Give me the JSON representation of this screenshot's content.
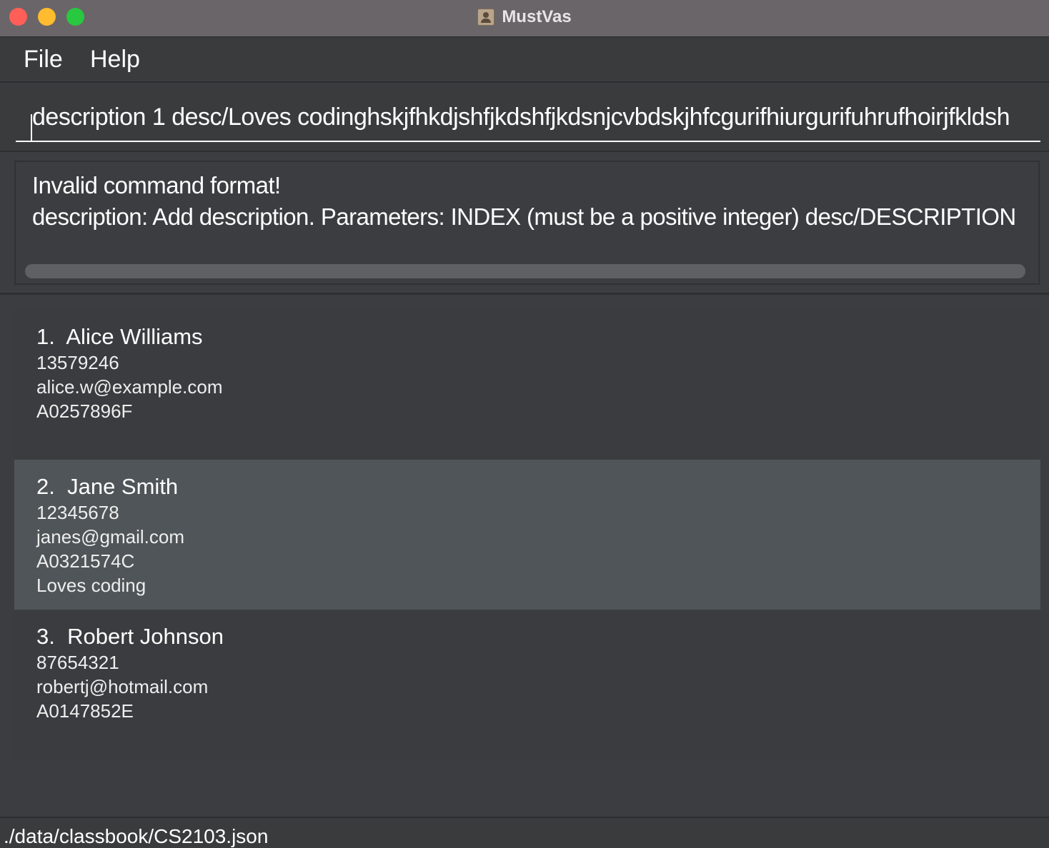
{
  "window": {
    "title": "MustVas"
  },
  "menu": {
    "file": "File",
    "help": "Help"
  },
  "command": {
    "value": "description 1 desc/Loves codinghskjfhkdjshfjkdshfjkdsnjcvbdskjhfcgurifhiurgurifuhrufhoirjfkldsh"
  },
  "result": {
    "line1": "Invalid command format!",
    "line2": "description: Add description. Parameters: INDEX (must be a positive integer) desc/DESCRIPTION"
  },
  "persons": [
    {
      "index": "1.",
      "name": "Alice Williams",
      "phone": "13579246",
      "email": "alice.w@example.com",
      "id": "A0257896F",
      "description": ""
    },
    {
      "index": "2.",
      "name": "Jane Smith",
      "phone": "12345678",
      "email": "janes@gmail.com",
      "id": "A0321574C",
      "description": "Loves coding"
    },
    {
      "index": "3.",
      "name": "Robert Johnson",
      "phone": "87654321",
      "email": "robertj@hotmail.com",
      "id": "A0147852E",
      "description": ""
    }
  ],
  "status": {
    "path": "./data/classbook/CS2103.json"
  }
}
